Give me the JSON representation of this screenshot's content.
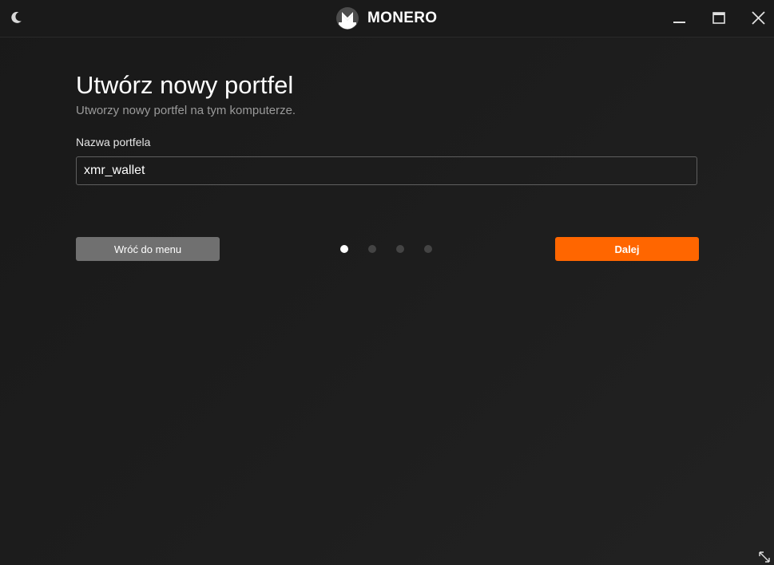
{
  "app": {
    "name": "MONERO"
  },
  "page": {
    "title": "Utwórz nowy portfel",
    "subtitle": "Utworzy nowy portfel na tym komputerze."
  },
  "form": {
    "wallet_name_label": "Nazwa portfela",
    "wallet_name_value": "xmr_wallet"
  },
  "buttons": {
    "back_label": "Wróć do menu",
    "next_label": "Dalej"
  },
  "progress": {
    "total_steps": 4,
    "current_step": 1
  },
  "colors": {
    "accent": "#ff6600",
    "back_button": "#707070",
    "background": "#1b1b1b"
  },
  "icons": {
    "theme": "moon-icon",
    "logo": "monero-logo-icon",
    "minimize": "minimize-icon",
    "maximize": "maximize-icon",
    "close": "close-icon",
    "resize": "resize-icon"
  }
}
